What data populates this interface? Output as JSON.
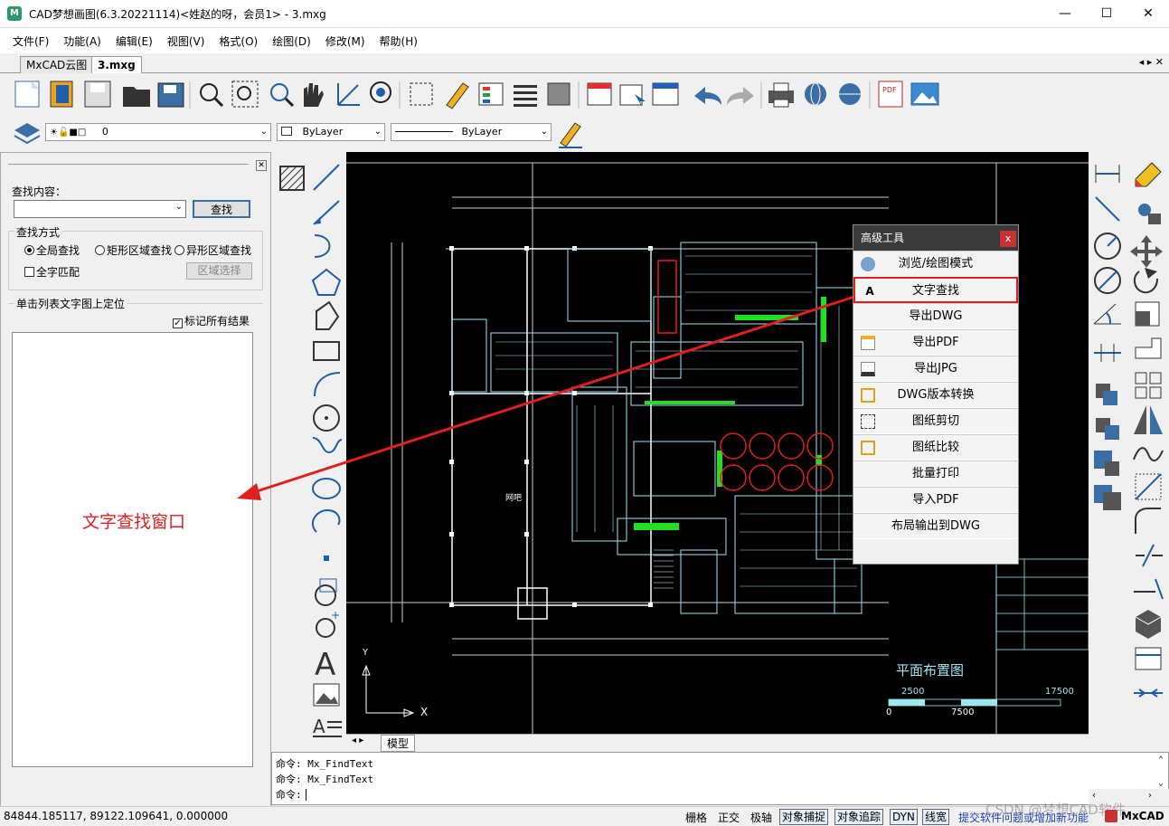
{
  "window": {
    "title": "CAD梦想画图(6.3.20221114)<姓赵的呀，会员1> - 3.mxg",
    "min": "—",
    "max": "☐",
    "close": "✕"
  },
  "menu": [
    "文件(F)",
    "功能(A)",
    "编辑(E)",
    "视图(V)",
    "格式(O)",
    "绘图(D)",
    "修改(M)",
    "帮助(H)"
  ],
  "tabs": [
    {
      "label": "MxCAD云图"
    },
    {
      "label": "3.mxg"
    }
  ],
  "tab_nav": "◂ ▸ ✕",
  "layer_bar": {
    "layer_value": "0",
    "color_value": "ByLayer",
    "linetype_value": "ByLayer"
  },
  "find_panel": {
    "label_content": "查找内容：",
    "input_value": "",
    "find_button": "查找",
    "group_mode": "查找方式",
    "radio_global": "全局查找",
    "radio_rect": "矩形区域查找",
    "radio_shape": "异形区域查找",
    "check_full_match": "全字匹配",
    "area_select_button": "区域选择",
    "list_hint": "单击列表文字图上定位",
    "check_mark_all": "标记所有结果",
    "annotation": "文字查找窗口"
  },
  "popup": {
    "title": "高级工具",
    "close": "x",
    "items": [
      {
        "label": "浏览/绘图模式",
        "icon": "globe-icon"
      },
      {
        "label": "文字查找",
        "icon": "text-find-icon"
      },
      {
        "label": "导出DWG",
        "icon": ""
      },
      {
        "label": "导出PDF",
        "icon": "pdf-file-icon"
      },
      {
        "label": "导出JPG",
        "icon": "jpg-file-icon"
      },
      {
        "label": "DWG版本转换",
        "icon": "convert-icon"
      },
      {
        "label": "图纸剪切",
        "icon": "cut-icon"
      },
      {
        "label": "图纸比较",
        "icon": "compare-icon"
      },
      {
        "label": "批量打印",
        "icon": ""
      },
      {
        "label": "导入PDF",
        "icon": ""
      },
      {
        "label": "布局输出到DWG",
        "icon": ""
      }
    ]
  },
  "canvas": {
    "drawing_title": "平面布置图",
    "room_label": "网吧",
    "scale_1": "2500",
    "scale_2": "17500",
    "scale_3": "0",
    "scale_4": "7500",
    "model_tab": "模型",
    "y_axis": "Y",
    "x_axis": "X"
  },
  "command": {
    "line1": "命令: Mx_FindText",
    "line2": "命令: Mx_FindText",
    "prompt": "命令:"
  },
  "status": {
    "coords": "84844.185117,  89122.109641,  0.000000",
    "grid": "栅格",
    "ortho": "正交",
    "polar": "极轴",
    "osnap": "对象捕捉",
    "otrack": "对象追踪",
    "dyn": "DYN",
    "lweight": "线宽",
    "feedback": "提交软件问题或增加新功能",
    "brand": "MxCAD",
    "watermark": "CSDN @梦想CAD软件"
  },
  "colors": {
    "accent_red": "#e02020",
    "cad_bg": "#000000",
    "cad_line": "#9ee6f0",
    "cad_green": "#20e020"
  }
}
